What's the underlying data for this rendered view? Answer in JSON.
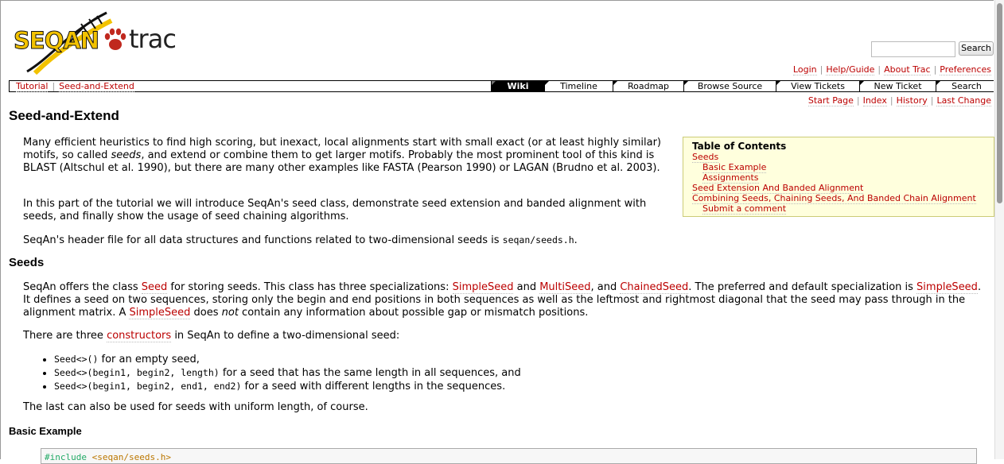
{
  "logo": {
    "seqan_text": "SEQAN",
    "trac_text": "trac"
  },
  "search": {
    "placeholder": "",
    "button_label": "Search"
  },
  "metanav": [
    "Login",
    "Help/Guide",
    "About Trac",
    "Preferences"
  ],
  "breadcrumbs": [
    "Tutorial",
    "Seed-and-Extend"
  ],
  "tabs": [
    "Wiki",
    "Timeline",
    "Roadmap",
    "Browse Source",
    "View Tickets",
    "New Ticket",
    "Search"
  ],
  "active_tab": "Wiki",
  "ctxtnav": [
    "Start Page",
    "Index",
    "History",
    "Last Change"
  ],
  "page_title": "Seed-and-Extend",
  "intro": {
    "p1a": "Many efficient heuristics to find high scoring, but inexact, local alignments start with small exact (or at least highly similar) motifs, so called ",
    "p1_em": "seeds",
    "p1b": ", and extend or combine them to get larger motifs. Probably the most prominent tool of this kind is BLAST (Altschul et al. 1990), but there are many other examples like FASTA (Pearson 1990) or LAGAN (Brudno et al. 2003).",
    "p2": "In this part of the tutorial we will introduce SeqAn's seed class, demonstrate seed extension and banded alignment with seeds, and finally show the usage of seed chaining algorithms.",
    "p3a": "SeqAn's header file for all data structures and functions related to two-dimensional seeds is ",
    "p3_code": "seqan/seeds.h",
    "p3b": "."
  },
  "toc": {
    "title": "Table of Contents",
    "items": [
      "Seeds",
      "Basic Example",
      "Assignments",
      "Seed Extension And Banded Alignment",
      "Combining Seeds, Chaining Seeds, And Banded Chain Alignment",
      "Submit a comment"
    ]
  },
  "seeds": {
    "heading": "Seeds",
    "s1": "SeqAn offers the class ",
    "link_seed": "Seed",
    "s2": " for storing seeds. This class has three specializations: ",
    "link_simple": "SimpleSeed",
    "s3": " and ",
    "link_multi": "MultiSeed",
    "s4": ", and ",
    "link_chained": "ChainedSeed",
    "s5": ". The preferred and default specialization is ",
    "link_simple2": "SimpleSeed",
    "s6": ". It defines a seed on two sequences, storing only the begin and end positions in both sequences as well as the leftmost and rightmost diagonal that the seed may pass through in the alignment matrix. A ",
    "link_simple3": "SimpleSeed",
    "s7": " does ",
    "s7_em": "not",
    "s8": " contain any information about possible gap or mismatch positions.",
    "c1": "There are three ",
    "link_constructors": "constructors",
    "c2": " in SeqAn to define a two-dimensional seed:",
    "list": [
      {
        "code": "Seed<>()",
        "text": " for an empty seed,"
      },
      {
        "code": "Seed<>(begin1, begin2, length)",
        "text": " for a seed that has the same length in all sequences, and"
      },
      {
        "code": "Seed<>(begin1, begin2, end1, end2)",
        "text": " for a seed with different lengths in the sequences."
      }
    ],
    "last": "The last can also be used for seeds with uniform length, of course."
  },
  "basic_example": {
    "heading": "Basic Example",
    "code_pp": "#include",
    "code_file": "<seqan/seeds.h>"
  }
}
